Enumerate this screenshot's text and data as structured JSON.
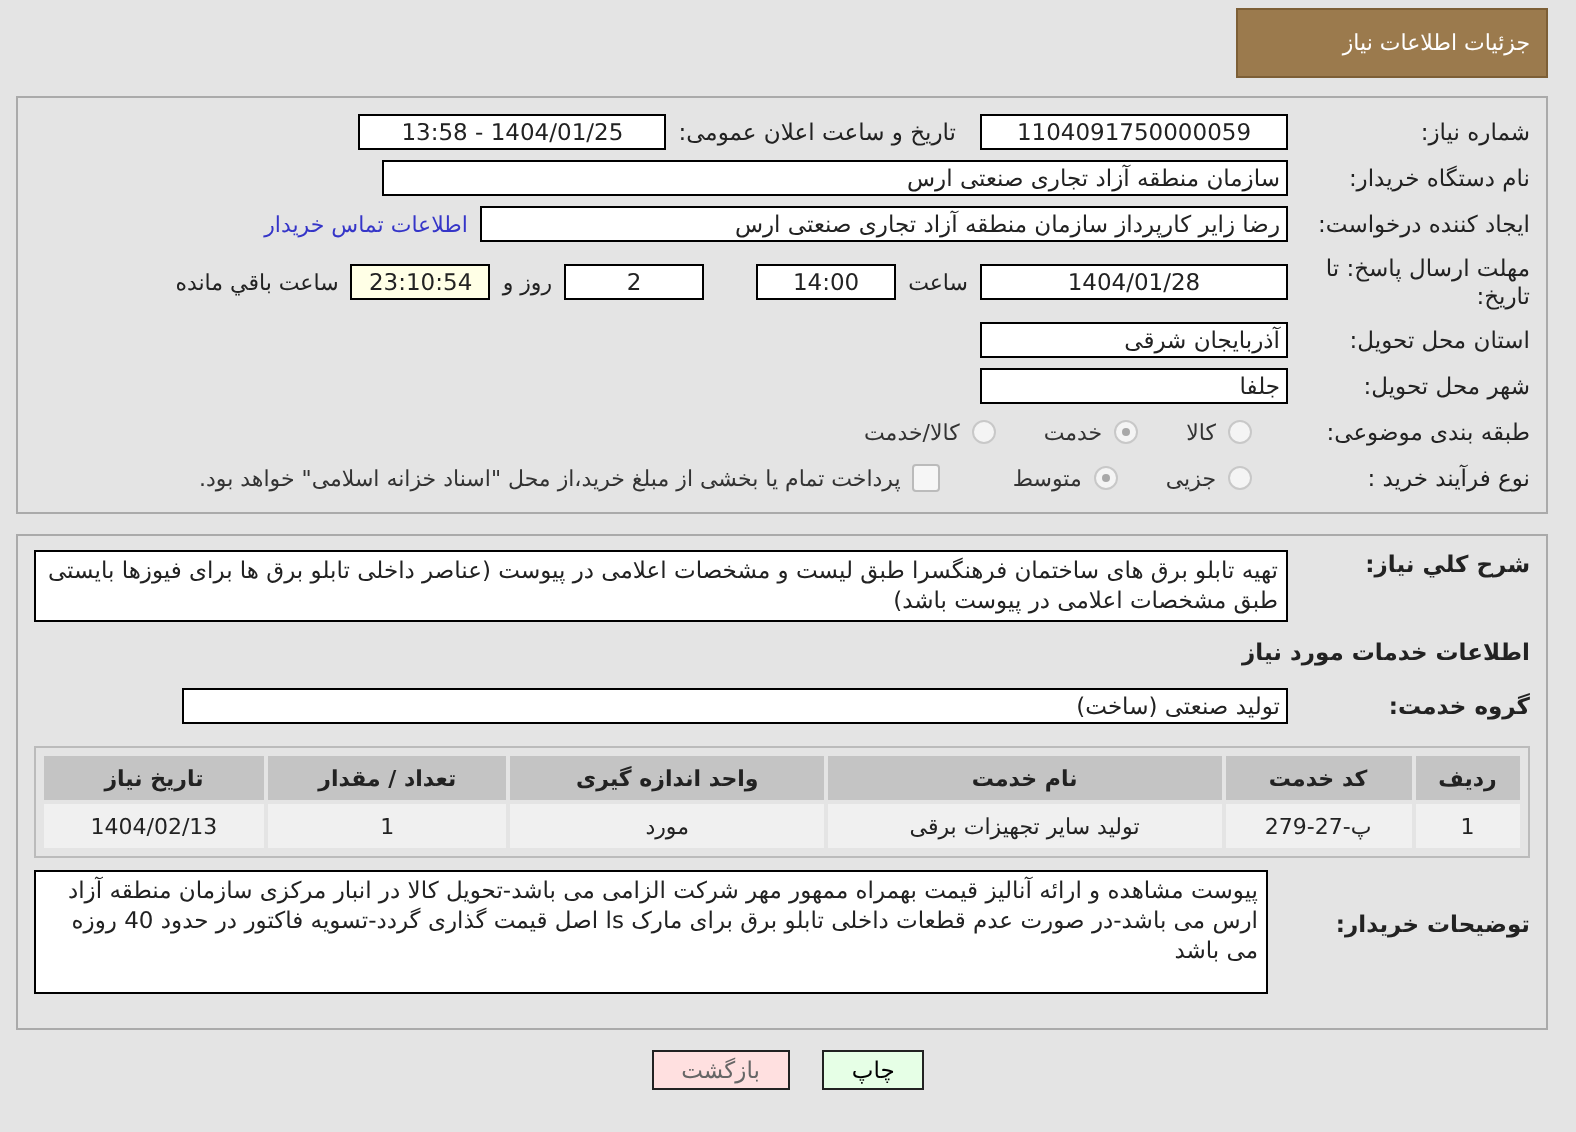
{
  "header": {
    "title": "جزئیات اطلاعات نیاز"
  },
  "fields": {
    "need_number": {
      "label": "شماره نیاز:",
      "value": "1104091750000059"
    },
    "announce": {
      "label": "تاریخ و ساعت اعلان عمومی:",
      "value": "1404/01/25 - 13:58"
    },
    "buyer_org": {
      "label": "نام دستگاه خریدار:",
      "value": "سازمان منطقه آزاد تجاری صنعتی ارس"
    },
    "requester": {
      "label": "ایجاد کننده درخواست:",
      "value": "رضا زایر کارپرداز سازمان منطقه آزاد تجاری صنعتی ارس",
      "link": "اطلاعات تماس خریدار"
    },
    "deadline": {
      "label": "مهلت ارسال پاسخ: تا تاریخ:",
      "date": "1404/01/28",
      "time_label": "ساعت",
      "time": "14:00",
      "days": "2",
      "days_label": "روز و",
      "remaining": "23:10:54",
      "remaining_label": "ساعت باقي مانده"
    },
    "province": {
      "label": "استان محل تحویل:",
      "value": "آذربایجان شرقی"
    },
    "city": {
      "label": "شهر محل تحویل:",
      "value": "جلفا"
    },
    "category": {
      "label": "طبقه بندی موضوعی:",
      "options": [
        {
          "label": "کالا",
          "selected": false
        },
        {
          "label": "خدمت",
          "selected": true
        },
        {
          "label": "کالا/خدمت",
          "selected": false
        }
      ]
    },
    "process": {
      "label": "نوع فرآیند خرید :",
      "options": [
        {
          "label": "جزیی",
          "selected": false
        },
        {
          "label": "متوسط",
          "selected": true
        }
      ],
      "payment": {
        "checked": false,
        "text": "پرداخت تمام یا بخشی از مبلغ خرید،از محل \"اسناد خزانه اسلامی\" خواهد بود."
      }
    }
  },
  "description": {
    "label": "شرح كلي نياز:",
    "value": "تهیه تابلو برق های ساختمان فرهنگسرا طبق لیست و مشخصات اعلامی در پیوست (عناصر داخلی تابلو برق ها برای فیوزها بایستی طبق مشخصات اعلامی در پیوست باشد)"
  },
  "services_title": "اطلاعات خدمات مورد نياز",
  "service_group": {
    "label": "گروه خدمت:",
    "value": "تولید صنعتی (ساخت)"
  },
  "table": {
    "columns": [
      "ردیف",
      "کد خدمت",
      "نام خدمت",
      "واحد اندازه گیری",
      "تعداد / مقدار",
      "تاریخ نیاز"
    ],
    "rows": [
      [
        "1",
        "پ-27-279",
        "تولید سایر تجهیزات برقی",
        "مورد",
        "1",
        "1404/02/13"
      ]
    ]
  },
  "buyer_notes": {
    "label": "توضیحات خریدار:",
    "value": "پیوست مشاهده و ارائه آنالیز قیمت بهمراه ممهور مهر شرکت الزامی می باشد-تحویل کالا در انبار مرکزی سازمان منطقه آزاد ارس می باشد-در صورت عدم قطعات داخلی تابلو برق برای مارک ls اصل قیمت گذاری گردد-تسویه فاکتور در حدود 40 روزه می باشد"
  },
  "buttons": [
    {
      "label": "چاپ",
      "kind": "print"
    },
    {
      "label": "بازگشت",
      "kind": "back"
    }
  ]
}
